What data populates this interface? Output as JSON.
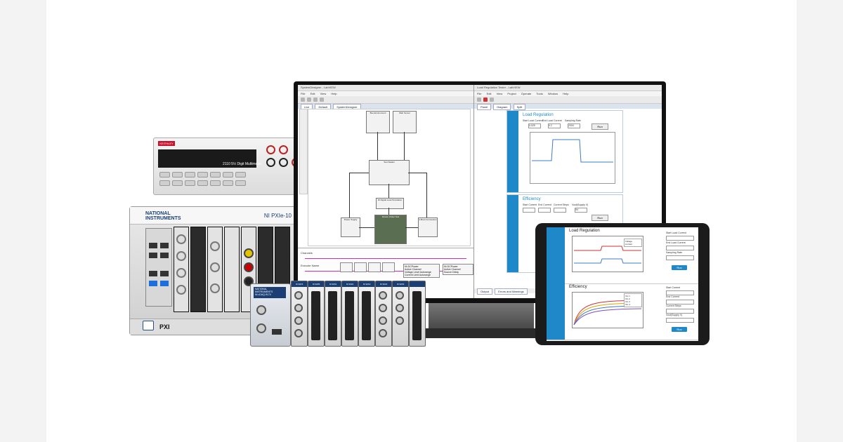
{
  "dmm": {
    "brand": "KEITHLEY",
    "model": "2110 5½ Digit Multimeter"
  },
  "pxi": {
    "vendor_line1": "NATIONAL",
    "vendor_line2": "INSTRUMENTS",
    "model": "NI PXIe-10",
    "badge": "PXI"
  },
  "monitor": {
    "left_title": "SystemDesigner - LabVIEW",
    "left_menus": [
      "File",
      "Edit",
      "View",
      "Help"
    ],
    "left_tabs": [
      "Live",
      "Default",
      "SystemDesigner"
    ],
    "nodes": {
      "n1": "Bus Environment",
      "n2": "Web Server",
      "n3": "Test Station",
      "n4": "NI Digital Load Simulation",
      "n5": "Device Under Test",
      "n6": "Power Supply",
      "n7": "4-Boot Connection"
    },
    "wave": {
      "channels": "Channels",
      "excel_name": "Execute Name",
      "node_a": [
        "NI-DCPower",
        "Active Channel",
        "Voltage Level Autorange",
        "Current Limit Autorange"
      ],
      "node_b": [
        "NI-DCPower",
        "Active Channel",
        "Source Delay"
      ],
      "footer_tabs": [
        "Output",
        "Errors and Warnings"
      ]
    },
    "right_title": "Load Regulation Tester - LabVIEW",
    "right_menus": [
      "File",
      "Edit",
      "View",
      "Project",
      "Operate",
      "Tools",
      "Window",
      "Help"
    ],
    "right_tabs": [
      "Panel",
      "Diagram",
      "Split"
    ],
    "lr": {
      "title": "Load Regulation",
      "labels": [
        "Start Load Current",
        "End Load Current",
        "Sampling Rate"
      ],
      "values": [
        "0.025",
        "0.2",
        "2000"
      ],
      "run": "Run"
    },
    "eff": {
      "title": "Efficiency",
      "labels": [
        "Start Current",
        "End Current",
        "Current Steps",
        "Vout(Supply V)",
        "5V"
      ],
      "run": "Run"
    },
    "right_footer_tabs": [
      "Output",
      "Errors and Warnings"
    ]
  },
  "tablet": {
    "lr_title": "Load Regulation",
    "lr_fields": [
      "Start Load Current",
      "End Load Current",
      "Sampling Rate"
    ],
    "lr_legend": [
      "Voltage",
      "Current"
    ],
    "lr_btn": "Run",
    "eff_title": "Efficiency",
    "eff_fields": [
      "Start Current",
      "End Current",
      "Current Steps",
      "Vout(Supply V)"
    ],
    "eff_legend": [
      "Vin 1",
      "Vin 2",
      "Vin 3",
      "Vin 4"
    ],
    "eff_btn": "Run"
  },
  "cdaq": {
    "controller_vendor": "NATIONAL INSTRUMENTS",
    "controller_model": "NI cDAQ-9174",
    "modules": [
      "NI 9215",
      "NI 9205",
      "NI 9201",
      "NI 9401",
      "NI 9219",
      "NI 9223",
      "NI 9203"
    ]
  },
  "colors": {
    "accent_blue": "#1e88c9",
    "ni_navy": "#1b3f74",
    "wire_pink": "#d12bb8",
    "trace_blue": "#3c7cc4"
  }
}
